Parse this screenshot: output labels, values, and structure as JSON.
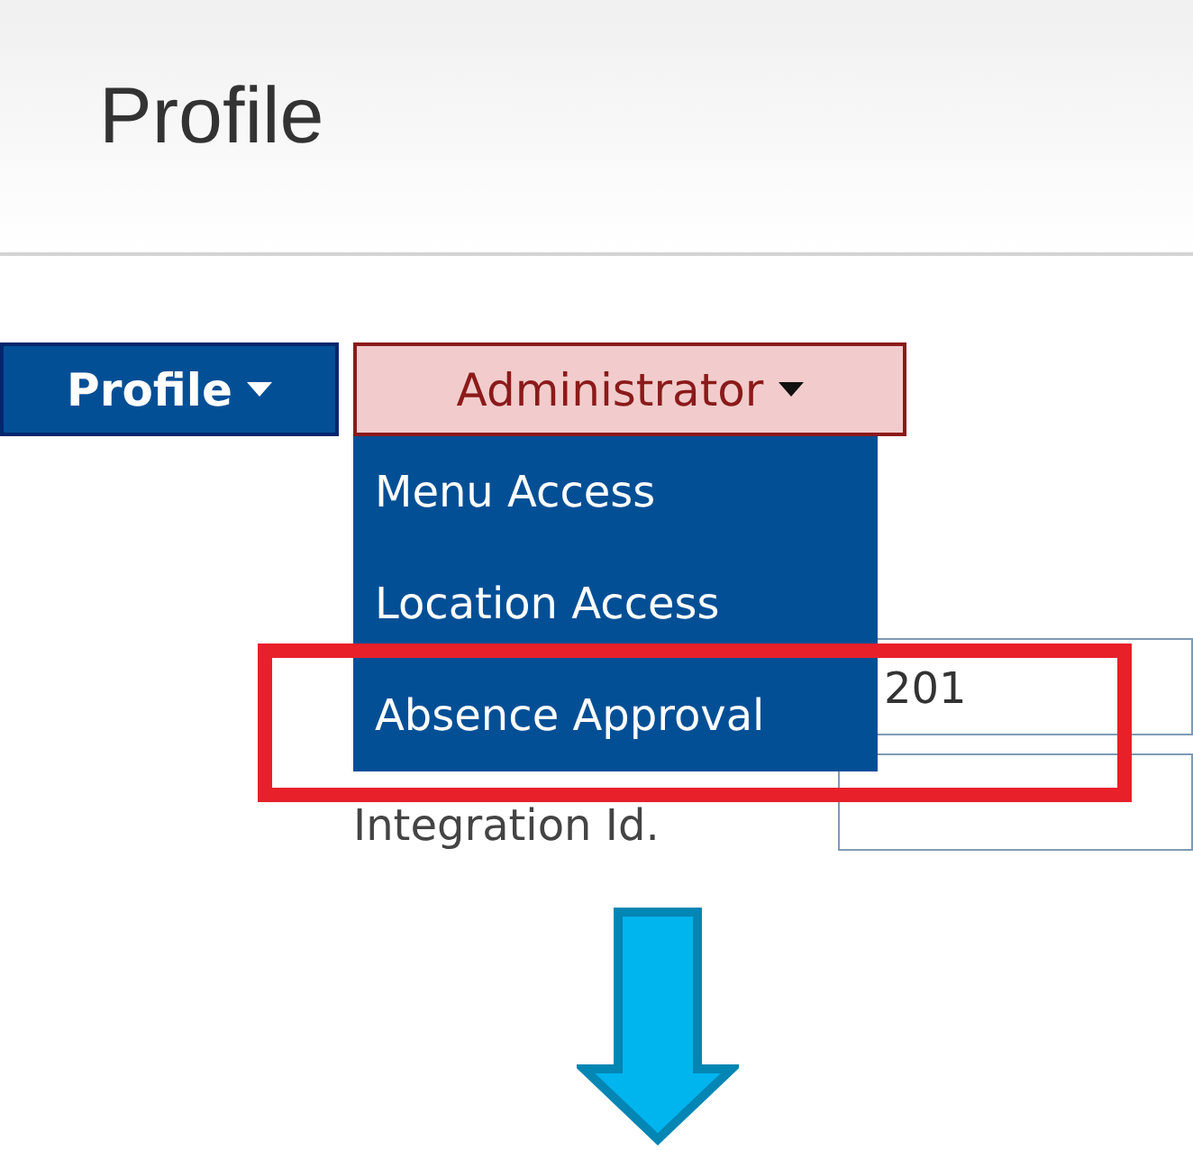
{
  "page": {
    "title": "Profile"
  },
  "nav": [
    {
      "label": "Profile",
      "selected": false
    },
    {
      "label": "Administrator",
      "selected": true,
      "expanded": true
    }
  ],
  "dropdown": {
    "items": [
      {
        "label": "Menu Access"
      },
      {
        "label": "Location Access"
      },
      {
        "label": "Absence Approval"
      }
    ]
  },
  "form": {
    "fields": [
      {
        "value": "201"
      },
      {
        "label": "Integration Id."
      }
    ]
  }
}
